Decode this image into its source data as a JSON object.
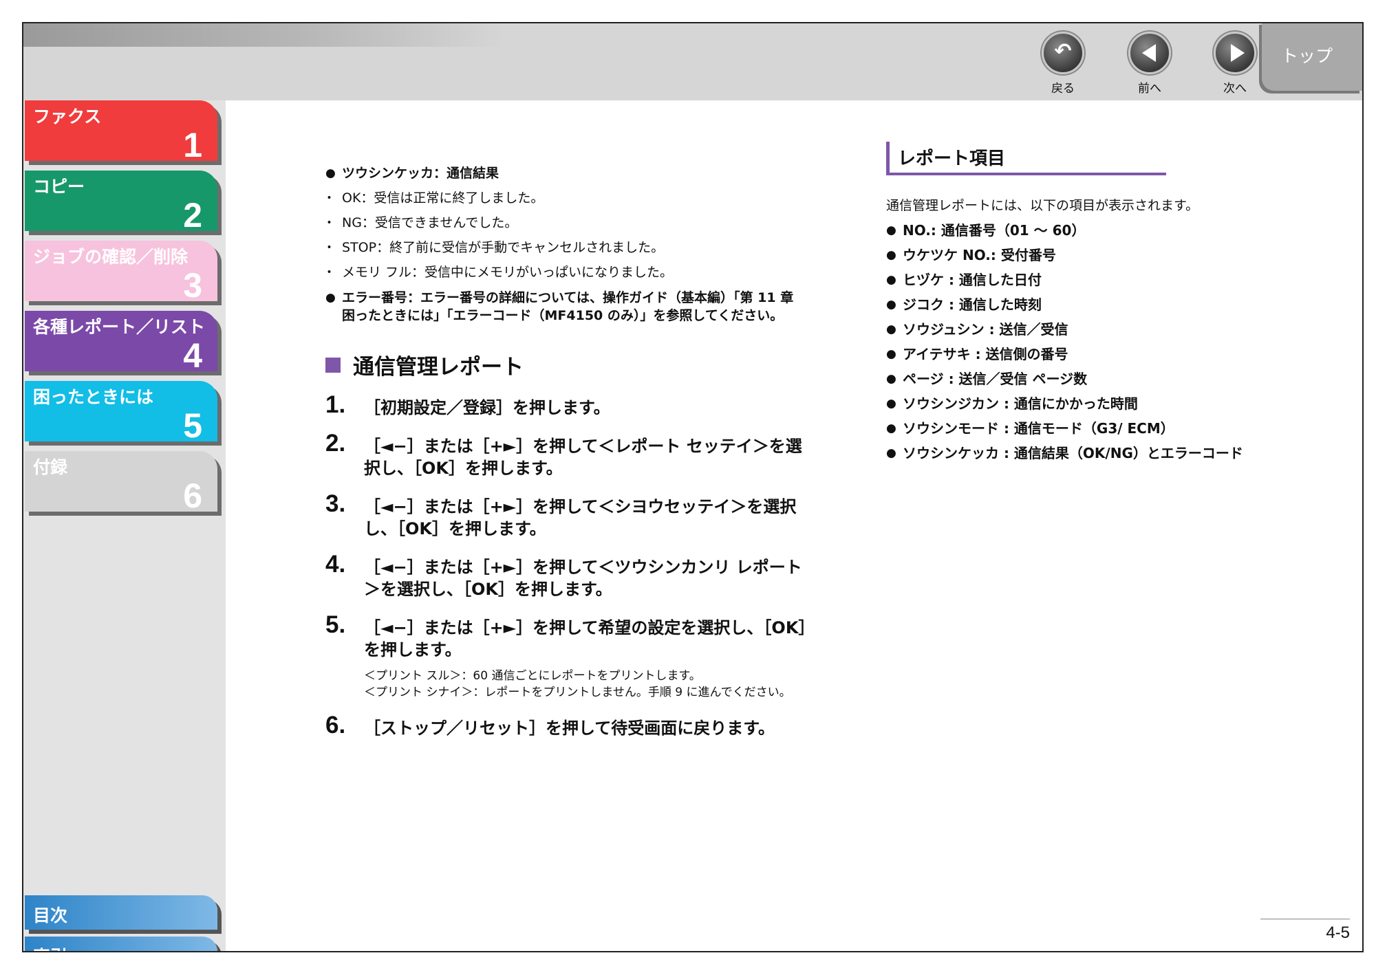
{
  "nav": {
    "back_label": "戻る",
    "prev_label": "前へ",
    "next_label": "次へ",
    "top_label": "トップ"
  },
  "chapters": [
    {
      "title": "ファクス",
      "number": "1",
      "color": "#f03c3c"
    },
    {
      "title": "コピー",
      "number": "2",
      "color": "#17986a"
    },
    {
      "title": "ジョブの確認／削除",
      "number": "3",
      "color": "#f7c2dd"
    },
    {
      "title": "各種レポート／リスト",
      "number": "4",
      "color": "#7b4aa8"
    },
    {
      "title": "困ったときには",
      "number": "5",
      "color": "#12bde6"
    },
    {
      "title": "付録",
      "number": "6",
      "color": "#d4d4d4"
    }
  ],
  "bottom_nav": {
    "contents": "目次",
    "index": "索引"
  },
  "left": {
    "result_heading": "ツウシンケッカ：通信結果",
    "results": [
      "OK：受信は正常に終了しました。",
      "NG：受信できませんでした。",
      "STOP：終了前に受信が手動でキャンセルされました。",
      "メモリ フル：受信中にメモリがいっぱいになりました。"
    ],
    "error_item": "エラー番号：エラー番号の詳細については、操作ガイド（基本編）「第 11 章 困ったときには」「エラーコード（MF4150 のみ）」を参照してください。",
    "section_title": "通信管理レポート",
    "steps": [
      {
        "num": "1.",
        "text": "［初期設定／登録］を押します。"
      },
      {
        "num": "2.",
        "text": "［◄−］または［+►］を押して＜レポート セッテイ＞を選択し、［OK］を押します。"
      },
      {
        "num": "3.",
        "text": "［◄−］または［+►］を押して＜シヨウセッテイ＞を選択し、［OK］を押します。"
      },
      {
        "num": "4.",
        "text": "［◄−］または［+►］を押して＜ツウシンカンリ レポート＞を選択し、［OK］を押します。"
      },
      {
        "num": "5.",
        "text": "［◄−］または［+►］を押して希望の設定を選択し、［OK］を押します。"
      },
      {
        "num": "6.",
        "text": "［ストップ／リセット］を押して待受画面に戻ります。"
      }
    ],
    "step5_note1": "＜プリント スル＞：60 通信ごとにレポートをプリントします。",
    "step5_note2": "＜プリント シナイ＞：レポートをプリントしません。手順 9 に進んでください。"
  },
  "right": {
    "heading": "レポート項目",
    "intro": "通信管理レポートには、以下の項目が表示されます。",
    "items": [
      "NO.: 通信番号（01 〜 60）",
      "ウケツケ NO.: 受付番号",
      "ヒヅケ : 通信した日付",
      "ジコク : 通信した時刻",
      "ソウジュシン : 送信／受信",
      "アイテサキ : 送信側の番号",
      "ページ : 送信／受信 ページ数",
      "ソウシンジカン : 通信にかかった時間",
      "ソウシンモード : 通信モード（G3/ ECM）",
      "ソウシンケッカ : 通信結果（OK/NG）とエラーコード"
    ]
  },
  "page_number": "4-5"
}
